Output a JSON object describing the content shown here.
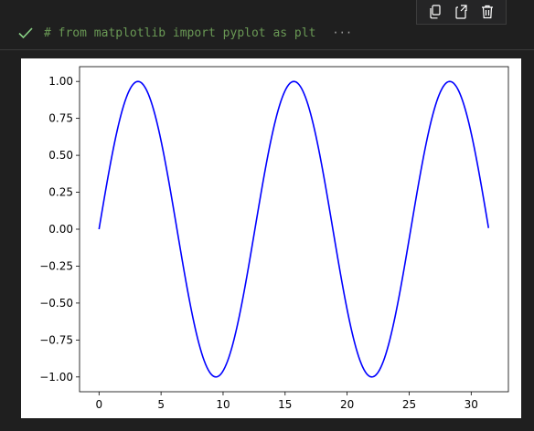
{
  "toolbar": {
    "buttons": [
      {
        "name": "copy-icon"
      },
      {
        "name": "copy-cell-icon"
      },
      {
        "name": "delete-icon"
      }
    ]
  },
  "cell": {
    "status": "success",
    "status_color": "#89d185",
    "collapsed_code": "# from matplotlib import pyplot as plt",
    "ellipsis": "···",
    "code_color": "#6a9955"
  },
  "chart_data": {
    "type": "line",
    "title": "",
    "xlabel": "",
    "ylabel": "",
    "xlim": [
      -1.57,
      33.0
    ],
    "ylim": [
      -1.1,
      1.1
    ],
    "x_ticks": [
      0,
      5,
      10,
      15,
      20,
      25,
      30
    ],
    "x_tick_labels": [
      "0",
      "5",
      "10",
      "15",
      "20",
      "25",
      "30"
    ],
    "y_ticks": [
      1.0,
      0.75,
      0.5,
      0.25,
      0.0,
      -0.25,
      -0.5,
      -0.75,
      -1.0
    ],
    "y_tick_labels": [
      "1.00",
      "0.75",
      "0.50",
      "0.25",
      "0.00",
      "−0.25",
      "−0.50",
      "−0.75",
      "−1.00"
    ],
    "grid": false,
    "series": [
      {
        "function": "sin(x / 2)",
        "x_start": 0,
        "x_end": 31.4,
        "samples": 300,
        "color": "#0000ff"
      }
    ]
  }
}
